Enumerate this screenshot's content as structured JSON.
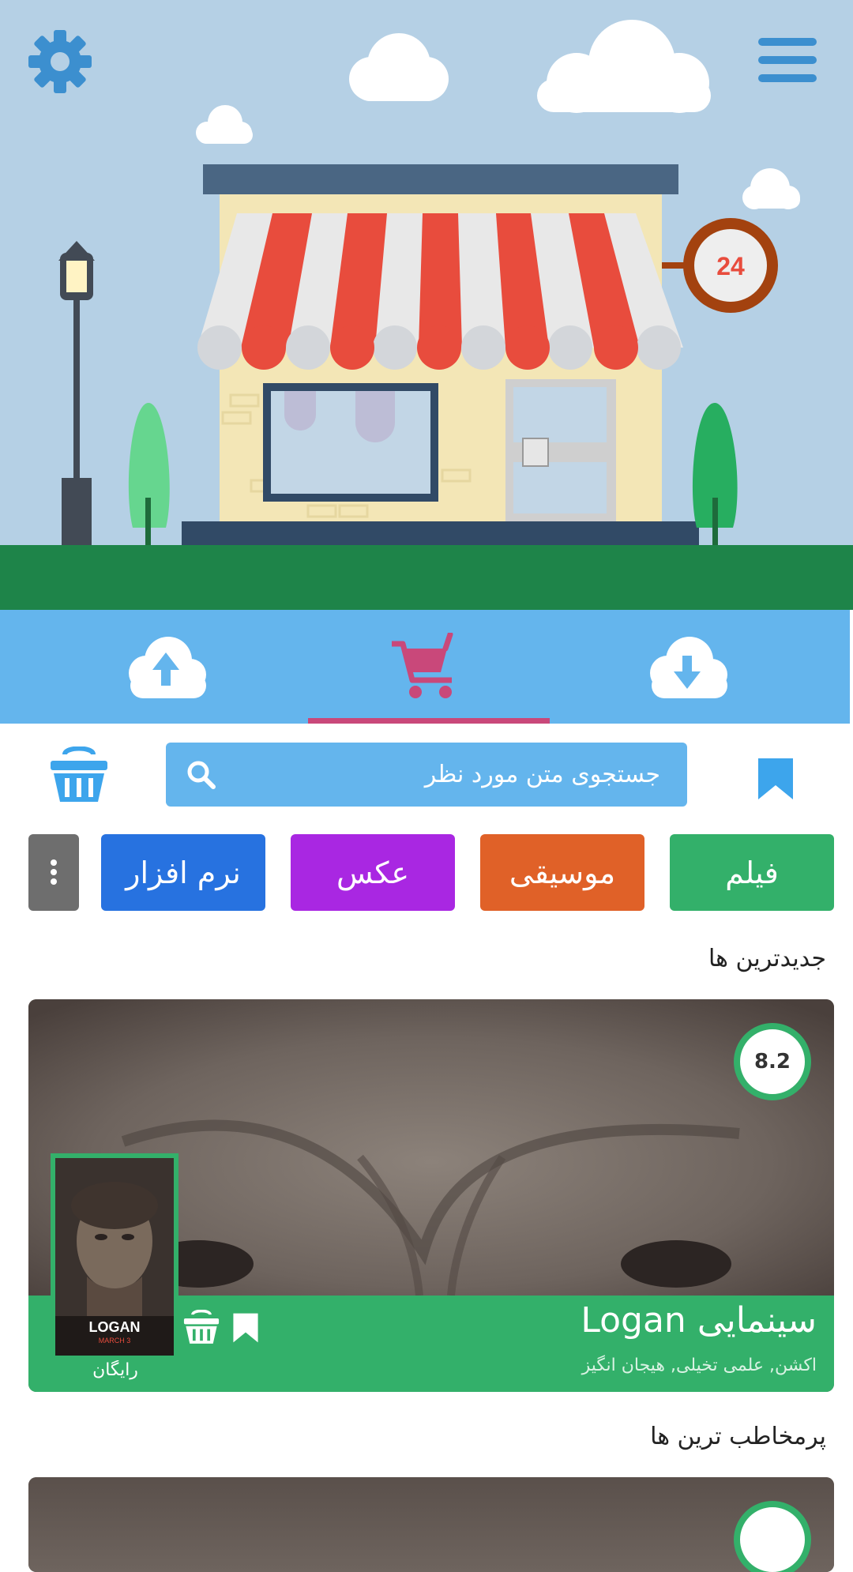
{
  "hero": {
    "sign_number": "24"
  },
  "tabs": [
    {
      "name": "upload",
      "icon": "cloud-upload-icon"
    },
    {
      "name": "shop",
      "icon": "shopping-cart-icon",
      "active": true
    },
    {
      "name": "download",
      "icon": "cloud-download-icon"
    }
  ],
  "search": {
    "placeholder": "جستجوی متن مورد نظر"
  },
  "categories": [
    {
      "label": "فیلم",
      "color": "#33b06a"
    },
    {
      "label": "موسیقی",
      "color": "#e06128"
    },
    {
      "label": "عکس",
      "color": "#a927e2"
    },
    {
      "label": "نرم افزار",
      "color": "#2772e0"
    }
  ],
  "sections": {
    "newest": "جدیدترین ها",
    "popular": "پرمخاطب ترین ها"
  },
  "featured": {
    "title": "سینمایی Logan",
    "genres": "اکشن, علمی تخیلی, هیجان انگیز",
    "rating": "8.2",
    "price": "رایگان",
    "poster_title": "LOGAN",
    "poster_date": "MARCH 3"
  },
  "colors": {
    "accent_blue": "#64b5ed",
    "accent_pink": "#c9487a",
    "green": "#33b06a"
  }
}
